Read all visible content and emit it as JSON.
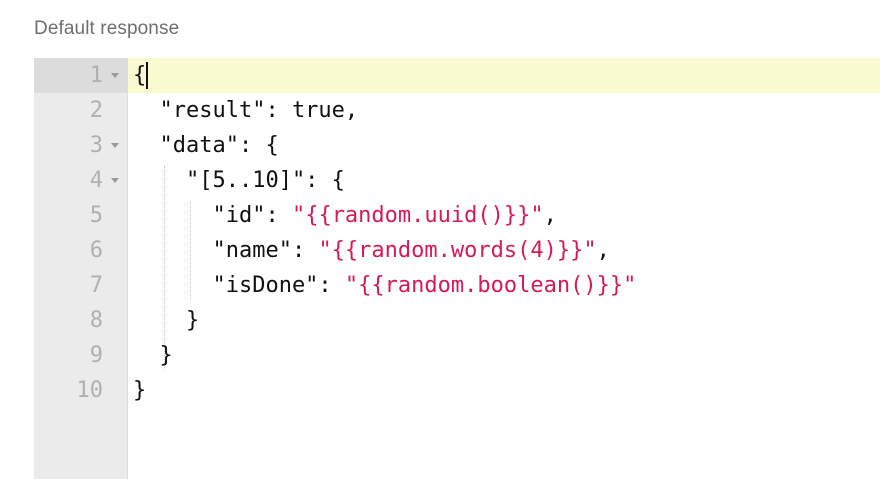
{
  "header": {
    "title": "Default response"
  },
  "editor": {
    "line_numbers": [
      "1",
      "2",
      "3",
      "4",
      "5",
      "6",
      "7",
      "8",
      "9",
      "10"
    ],
    "lines": [
      {
        "pre": "{",
        "val": "",
        "post": ""
      },
      {
        "pre": "  \"result\": true,",
        "val": "",
        "post": ""
      },
      {
        "pre": "  \"data\": {",
        "val": "",
        "post": ""
      },
      {
        "pre": "    \"[5..10]\": {",
        "val": "",
        "post": ""
      },
      {
        "pre": "      \"id\": ",
        "val": "\"{{random.uuid()}}\"",
        "post": ","
      },
      {
        "pre": "      \"name\": ",
        "val": "\"{{random.words(4)}}\"",
        "post": ","
      },
      {
        "pre": "      \"isDone\": ",
        "val": "\"{{random.boolean()}}\"",
        "post": ""
      },
      {
        "pre": "    }",
        "val": "",
        "post": ""
      },
      {
        "pre": "  }",
        "val": "",
        "post": ""
      },
      {
        "pre": "}",
        "val": "",
        "post": ""
      }
    ],
    "active_line": 1,
    "fold_lines": [
      1,
      3,
      4
    ],
    "colors": {
      "string_value": "#d6195b",
      "active_line_bg": "#fafad0",
      "gutter_bg": "#ebebeb"
    }
  }
}
